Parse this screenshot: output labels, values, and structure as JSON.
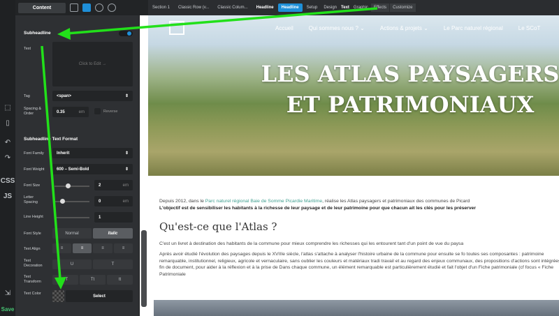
{
  "toolbar": {
    "content_tab": "Content",
    "save": "Save",
    "css": "CSS",
    "js": "JS"
  },
  "breadcrumbs": [
    "Section 1",
    "Classic Row (v...",
    "Classic Colum...",
    "Headline",
    "Headline",
    "Setup",
    "Design",
    "Text",
    "Graphic",
    "Effects",
    "Customize"
  ],
  "panel": {
    "subheadline": "Subheadline",
    "text_label": "Text",
    "click_to_edit": "Click to Edit →",
    "tag_label": "Tag",
    "tag_value": "<span>",
    "spacing_label": "Spacing & Order",
    "spacing_value": "0.35",
    "spacing_unit": "em",
    "reverse": "Reverse",
    "format_title": "Subheadline Text Format",
    "font_family_label": "Font Family",
    "font_family_value": "Inherit",
    "font_weight_label": "Font Weight",
    "font_weight_value": "600 – Semi-Bold",
    "font_size_label": "Font Size",
    "font_size_value": "2",
    "font_size_unit": "em",
    "letter_spacing_label": "Letter Spacing",
    "letter_spacing_value": "0",
    "letter_spacing_unit": "em",
    "line_height_label": "Line Height",
    "line_height_value": "1",
    "font_style_label": "Font Style",
    "normal": "Normal",
    "italic": "Italic",
    "text_align_label": "Text Align",
    "text_decoration_label": "Text Decoration",
    "text_transform_label": "Text Transform",
    "text_color_label": "Text Color",
    "select": "Select"
  },
  "site": {
    "nav": [
      "Accueil",
      "Qui sommes nous ? ⌄",
      "Actions & projets ⌄",
      "Le Parc naturel régional",
      "Le SCoT"
    ],
    "hero_title": "LES ATLAS PAYSAGERS ET PATRIMONIAUX",
    "p1_start": "Depuis 2012, dans le ",
    "p1_link": "Parc naturel régional Baie de Somme Picardie Maritime",
    "p1_end": ", réalise les Atlas paysagers et patrimoniaux des communes de Picard",
    "p1_bold": "L'objectif est de sensibiliser les habitants à la richesse de leur paysage et de leur patrimoine pour que chacun ait les clés pour les préserver",
    "h2": "Qu'est-ce que l'Atlas ?",
    "p2": "C'est un livret à destination des habitants de la commune pour mieux comprendre les richesses qui les entourent tant d'un point de vue du paysa",
    "p3": "Après avoir étudié l'évolution des paysages depuis le XVIIIe siècle, l'atlas s'attache à analyser l'histoire urbaine de la commune pour ensuite se fo toutes ses composantes : patrimoine remarquable, institutionnel, religieux, agricole et vernaculaire, sans oublier les couleurs et matériaux tradi travail et au regard des enjeux communaux, des propositions d'actions sont intégrées en fin de document, pour aider à la réflexion et à la prise de Dans chaque commune, un élément remarquable est particulièrement étudié et fait l'objet d'un Fiche patrimoniale (cf focus « Fiche Patrimoniale"
  },
  "colors": {
    "accent": "#1e8fd8",
    "arrow": "#22e01a",
    "panel": "#2e3033"
  }
}
